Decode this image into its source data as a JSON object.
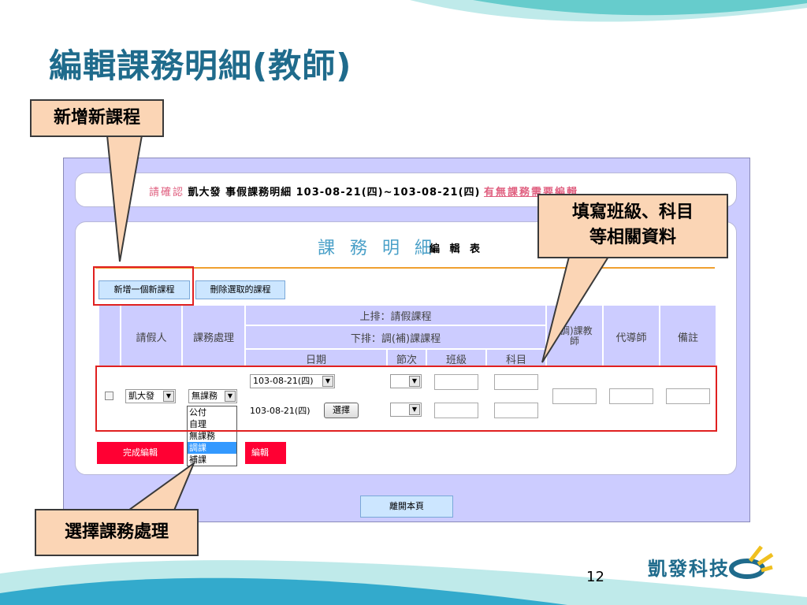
{
  "slide": {
    "title": "編輯課務明細(教師)",
    "page_number": "12",
    "logo_text": "凱發科技"
  },
  "callouts": {
    "add_course": "新增新課程",
    "fill_class": "填寫班級、科目\n等相關資料",
    "select_handling": "選擇課務處理"
  },
  "screen": {
    "confirm_prefix": "請確認",
    "confirm_middle": "凱大發 事假課務明細 103-08-21(四)~103-08-21(四)",
    "confirm_suffix": "有無課務需要編輯",
    "form_title": "課 務 明 細",
    "form_title_sub": "編 輯 表",
    "buttons": {
      "add": "新增一個新課程",
      "delete": "刪除選取的課程",
      "finish": "完成編輯",
      "cancel": "編輯",
      "leave": "離開本頁",
      "choose": "選擇"
    },
    "headers": {
      "leave_person": "請假人",
      "handling": "課務處理",
      "upper": "上排：請假課程",
      "lower": "下排：調(補)課課程",
      "date": "日期",
      "period": "節次",
      "class": "班級",
      "subject": "科目",
      "swap_teacher": "(調)課教師",
      "substitute": "代導師",
      "note": "備註"
    },
    "row": {
      "teacher": "凱大發",
      "handling": "無課務",
      "date_upper": "103-08-21(四)",
      "date_lower": "103-08-21(四)"
    },
    "handling_options": [
      "公付",
      "自理",
      "無課務",
      "調課",
      "補課"
    ],
    "handling_highlighted": "調課"
  },
  "colors": {
    "title": "#1f6b8c",
    "screen_bg": "#ccccff",
    "highlight_box": "#e02020",
    "callout_fill": "#fbd5b5",
    "accent_red": "#ff0033"
  }
}
